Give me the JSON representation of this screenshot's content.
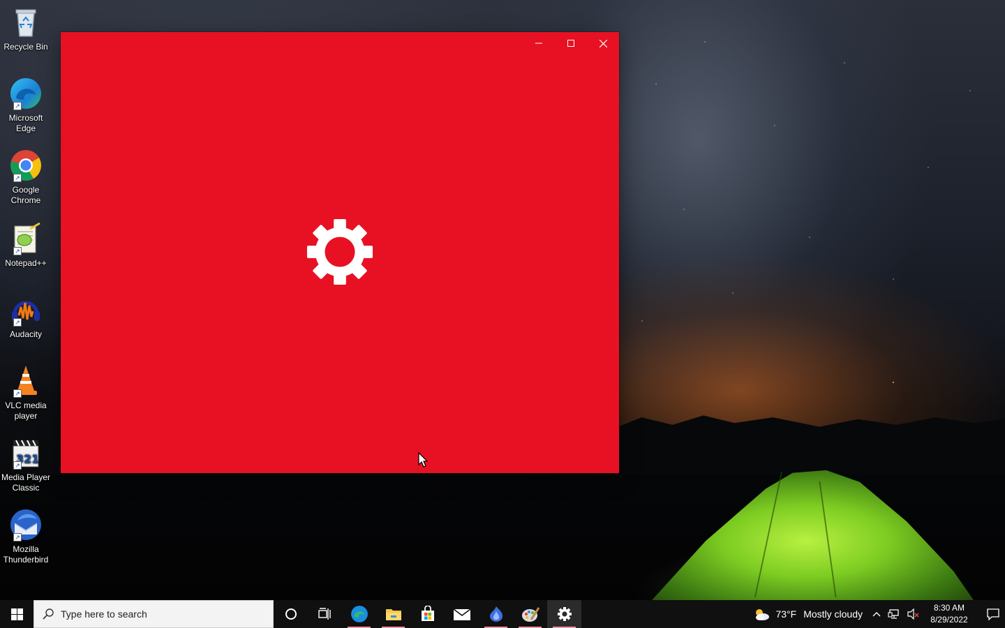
{
  "desktop": {
    "icons": [
      {
        "label": "Recycle Bin",
        "icon": "recycle-bin-icon"
      },
      {
        "label": "Microsoft Edge",
        "icon": "edge-icon"
      },
      {
        "label": "Google Chrome",
        "icon": "chrome-icon"
      },
      {
        "label": "Notepad++",
        "icon": "notepadpp-icon"
      },
      {
        "label": "Audacity",
        "icon": "audacity-icon"
      },
      {
        "label": "VLC media player",
        "icon": "vlc-icon"
      },
      {
        "label": "Media Player Classic",
        "icon": "mpc-icon"
      },
      {
        "label": "Mozilla Thunderbird",
        "icon": "thunderbird-icon"
      }
    ]
  },
  "window": {
    "background": "#e81123",
    "splash_icon": "gear-icon",
    "controls": [
      "minimize-icon",
      "maximize-icon",
      "close-icon"
    ]
  },
  "taskbar": {
    "search_placeholder": "Type here to search",
    "pinned": [
      {
        "icon": "cortana-icon"
      },
      {
        "icon": "task-view-icon"
      },
      {
        "icon": "edge-icon",
        "running": true
      },
      {
        "icon": "file-explorer-icon",
        "running": true
      },
      {
        "icon": "store-icon"
      },
      {
        "icon": "mail-icon"
      },
      {
        "icon": "app-flame-icon",
        "running": true
      },
      {
        "icon": "paint-icon",
        "running": true
      },
      {
        "icon": "settings-icon",
        "running": true,
        "active": true
      }
    ],
    "weather": {
      "temp": "73°F",
      "condition": "Mostly cloudy",
      "icon": "cloudy-sun-icon"
    },
    "clock": {
      "time": "8:30 AM",
      "date": "8/29/2022"
    },
    "accent": "#f08fa8"
  }
}
